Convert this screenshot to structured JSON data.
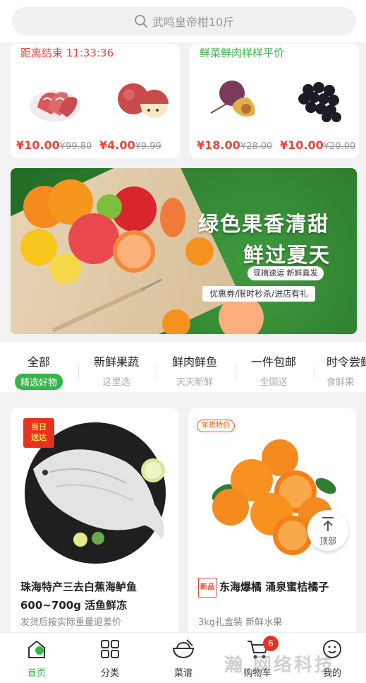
{
  "search": {
    "placeholder": "武鸣皇帝柑10斤"
  },
  "deals": {
    "left": {
      "title": "距离结束 11:33:36",
      "items": [
        {
          "name": "shrimp",
          "price": "¥10.00",
          "old_price": "¥99.80"
        },
        {
          "name": "apple",
          "price": "¥4.00",
          "old_price": "¥9.99"
        }
      ]
    },
    "right": {
      "title": "鲜菜鲜肉样样平价",
      "items": [
        {
          "name": "plum",
          "price": "¥18.00",
          "old_price": "¥28.00"
        },
        {
          "name": "grapes",
          "price": "¥10.00",
          "old_price": "¥20.00"
        }
      ]
    }
  },
  "banner": {
    "title": "绿色果香清甜",
    "subtitle": "鲜过夏天",
    "tag1": "现摘速运 新鲜直发",
    "tag2": "优惠券/限时秒杀/进店有礼"
  },
  "tabs": [
    {
      "label": "全部",
      "sub": "精选好物"
    },
    {
      "label": "新鲜果蔬",
      "sub": "这里选"
    },
    {
      "label": "鲜肉鲜鱼",
      "sub": "天天新鲜"
    },
    {
      "label": "一件包邮",
      "sub": "全国送"
    },
    {
      "label": "时令尝鲜",
      "sub": "食鲜果"
    }
  ],
  "products": [
    {
      "stamp": "当日送达",
      "stamp_line1": "当日",
      "stamp_line2": "送达",
      "name": "珠海特产三去白蕉海鲈鱼600~700g 活鱼鲜冻",
      "desc": "发货后按实际重量退差价"
    },
    {
      "stamp": "年货特价",
      "badge": "新品",
      "name": "东海爆橘 涌泉蜜桔橘子",
      "desc": "3kg礼盒装 新鲜水果"
    }
  ],
  "back_to_top": "顶部",
  "nav": [
    {
      "label": "首页",
      "icon": "home-icon"
    },
    {
      "label": "分类",
      "icon": "grid-icon"
    },
    {
      "label": "菜谱",
      "icon": "bowl-icon"
    },
    {
      "label": "购物车",
      "icon": "cart-icon",
      "badge": "6"
    },
    {
      "label": "我的",
      "icon": "smile-icon"
    }
  ],
  "watermark": "瀚 网络科技",
  "colors": {
    "accent": "#35b64a",
    "price": "#e8453c",
    "deal_title_green": "#3cb34a"
  }
}
